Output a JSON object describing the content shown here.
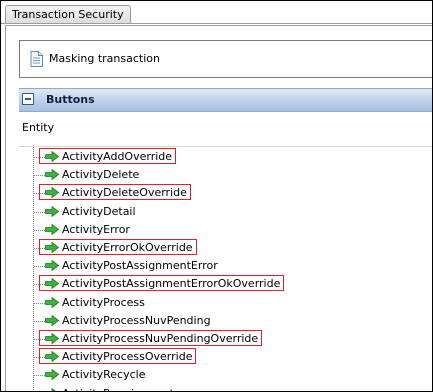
{
  "tab": {
    "label": "Transaction Security"
  },
  "masking": {
    "label": "Masking transaction",
    "icon": "document-icon"
  },
  "section": {
    "title": "Buttons",
    "toggle_icon": "collapse-minus-icon"
  },
  "entity": {
    "label": "Entity"
  },
  "colors": {
    "highlight": "#e0202a",
    "arrow": "#3fb23f",
    "header": "#bcd0e8"
  },
  "tree": {
    "items": [
      {
        "label": "ActivityAddOverride",
        "highlighted": true
      },
      {
        "label": "ActivityDelete",
        "highlighted": false
      },
      {
        "label": "ActivityDeleteOverride",
        "highlighted": true
      },
      {
        "label": "ActivityDetail",
        "highlighted": false
      },
      {
        "label": "ActivityError",
        "highlighted": false
      },
      {
        "label": "ActivityErrorOkOverride",
        "highlighted": true
      },
      {
        "label": "ActivityPostAssignmentError",
        "highlighted": false
      },
      {
        "label": "ActivityPostAssignmentErrorOkOverride",
        "highlighted": true
      },
      {
        "label": "ActivityProcess",
        "highlighted": false
      },
      {
        "label": "ActivityProcessNuvPending",
        "highlighted": false
      },
      {
        "label": "ActivityProcessNuvPendingOverride",
        "highlighted": true
      },
      {
        "label": "ActivityProcessOverride",
        "highlighted": true
      },
      {
        "label": "ActivityRecycle",
        "highlighted": false
      },
      {
        "label": "ActivityRequirement",
        "highlighted": false
      }
    ]
  }
}
